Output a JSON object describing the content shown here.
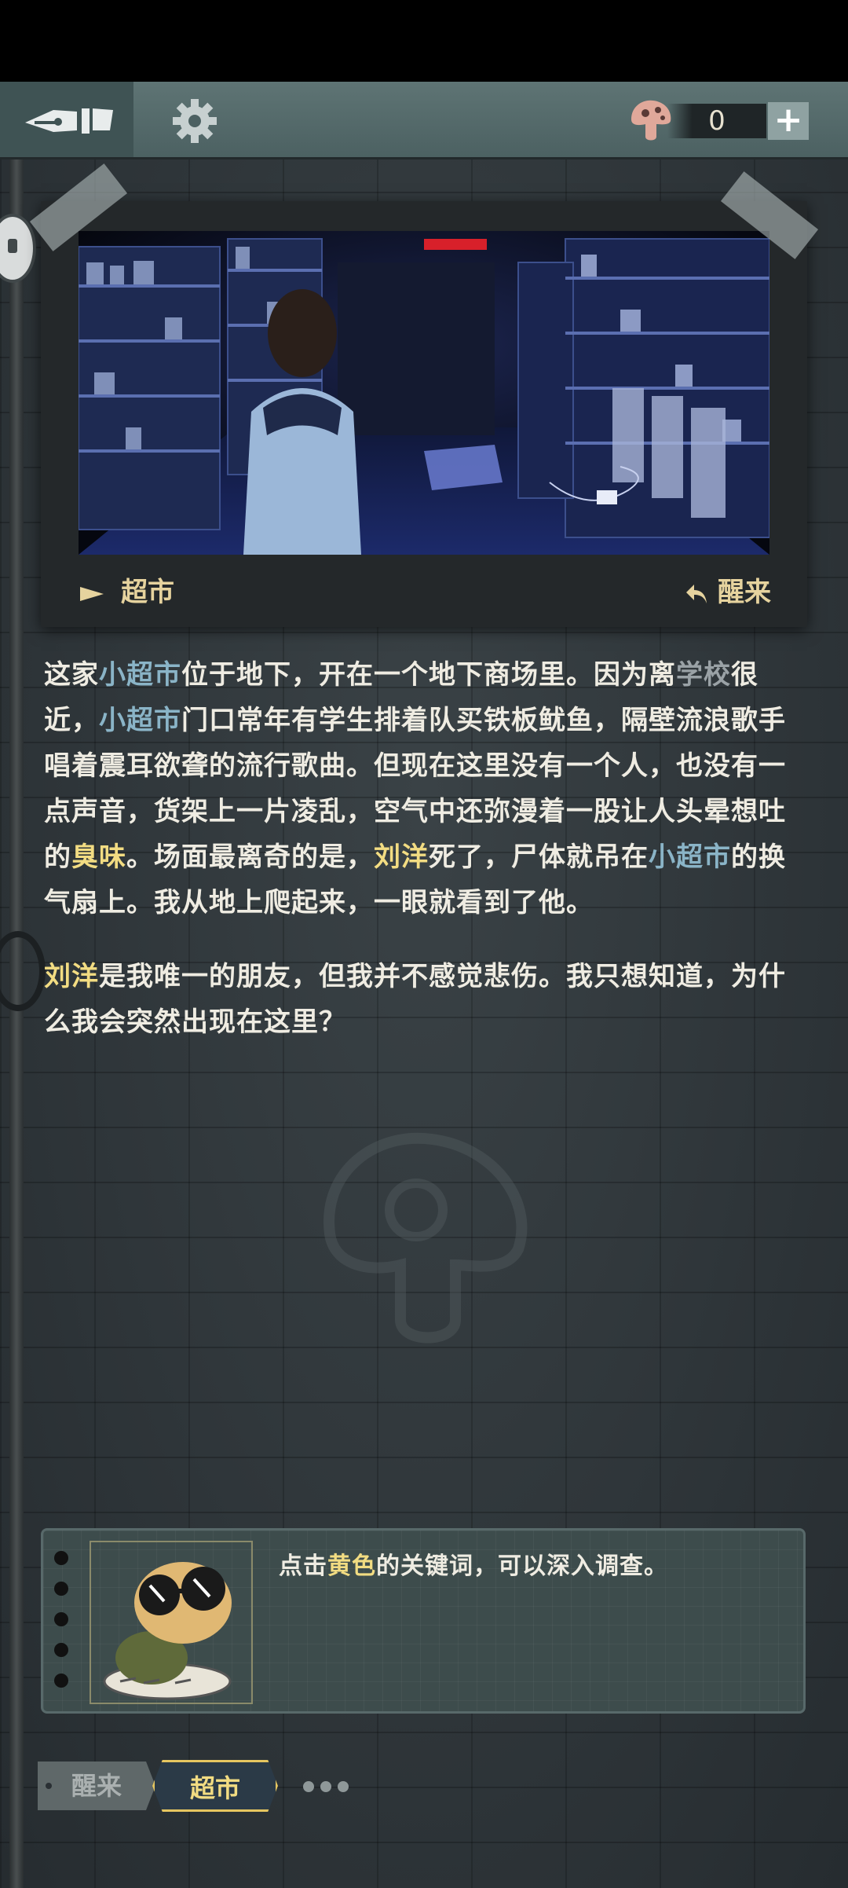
{
  "top_bar": {
    "currency_value": "0",
    "plus_label": "+",
    "icons": [
      "quill-icon",
      "gear-icon",
      "mushroom-icon"
    ]
  },
  "scene": {
    "location_label": "超市",
    "wake_label": "醒来",
    "neon_color": "#d8202a"
  },
  "story": {
    "paragraph1": [
      {
        "t": "这家",
        "k": ""
      },
      {
        "t": "小超市",
        "k": "blue"
      },
      {
        "t": "位于地下，开在一个地下商场里。因为离",
        "k": ""
      },
      {
        "t": "学校",
        "k": "grey"
      },
      {
        "t": "很近，",
        "k": ""
      },
      {
        "t": "小超市",
        "k": "blue"
      },
      {
        "t": "门口常年有学生排着队买铁板鱿鱼，隔壁流浪歌手唱着震耳欲聋的流行歌曲。但现在这里没有一个人，也没有一点声音，货架上一片凌乱，空气中还弥漫着一股让人头晕想吐的",
        "k": ""
      },
      {
        "t": "臭味",
        "k": "yellow"
      },
      {
        "t": "。场面最离奇的是，",
        "k": ""
      },
      {
        "t": "刘洋",
        "k": "yellow"
      },
      {
        "t": "死了，尸体就吊在",
        "k": ""
      },
      {
        "t": "小超市",
        "k": "blue"
      },
      {
        "t": "的换气扇上。我从地上爬起来，一眼就看到了他。",
        "k": ""
      }
    ],
    "paragraph2": [
      {
        "t": "刘洋",
        "k": "yellow"
      },
      {
        "t": "是我唯一的朋友，但我并不感觉悲伤。我只想知道，为什么我会突然出现在这里？",
        "k": ""
      }
    ]
  },
  "hint": {
    "prefix": "点击",
    "keyword": "黄色",
    "suffix": "的关键词，可以深入调查。"
  },
  "tabs": {
    "previous": "醒来",
    "current": "超市"
  },
  "colors": {
    "keyword_yellow": "#f2dc82",
    "keyword_blue": "#8ab4c7",
    "accent_gold": "#e6d39e"
  }
}
